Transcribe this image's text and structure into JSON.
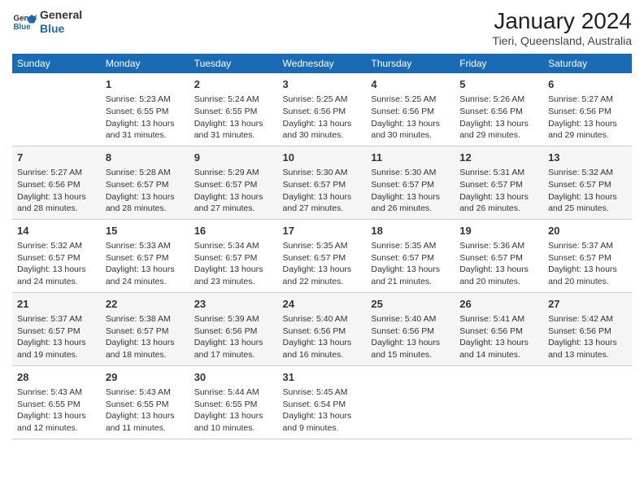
{
  "logo": {
    "line1": "General",
    "line2": "Blue"
  },
  "title": "January 2024",
  "subtitle": "Tieri, Queensland, Australia",
  "headers": [
    "Sunday",
    "Monday",
    "Tuesday",
    "Wednesday",
    "Thursday",
    "Friday",
    "Saturday"
  ],
  "weeks": [
    [
      {
        "num": "",
        "info": ""
      },
      {
        "num": "1",
        "info": "Sunrise: 5:23 AM\nSunset: 6:55 PM\nDaylight: 13 hours\nand 31 minutes."
      },
      {
        "num": "2",
        "info": "Sunrise: 5:24 AM\nSunset: 6:55 PM\nDaylight: 13 hours\nand 31 minutes."
      },
      {
        "num": "3",
        "info": "Sunrise: 5:25 AM\nSunset: 6:56 PM\nDaylight: 13 hours\nand 30 minutes."
      },
      {
        "num": "4",
        "info": "Sunrise: 5:25 AM\nSunset: 6:56 PM\nDaylight: 13 hours\nand 30 minutes."
      },
      {
        "num": "5",
        "info": "Sunrise: 5:26 AM\nSunset: 6:56 PM\nDaylight: 13 hours\nand 29 minutes."
      },
      {
        "num": "6",
        "info": "Sunrise: 5:27 AM\nSunset: 6:56 PM\nDaylight: 13 hours\nand 29 minutes."
      }
    ],
    [
      {
        "num": "7",
        "info": "Sunrise: 5:27 AM\nSunset: 6:56 PM\nDaylight: 13 hours\nand 28 minutes."
      },
      {
        "num": "8",
        "info": "Sunrise: 5:28 AM\nSunset: 6:57 PM\nDaylight: 13 hours\nand 28 minutes."
      },
      {
        "num": "9",
        "info": "Sunrise: 5:29 AM\nSunset: 6:57 PM\nDaylight: 13 hours\nand 27 minutes."
      },
      {
        "num": "10",
        "info": "Sunrise: 5:30 AM\nSunset: 6:57 PM\nDaylight: 13 hours\nand 27 minutes."
      },
      {
        "num": "11",
        "info": "Sunrise: 5:30 AM\nSunset: 6:57 PM\nDaylight: 13 hours\nand 26 minutes."
      },
      {
        "num": "12",
        "info": "Sunrise: 5:31 AM\nSunset: 6:57 PM\nDaylight: 13 hours\nand 26 minutes."
      },
      {
        "num": "13",
        "info": "Sunrise: 5:32 AM\nSunset: 6:57 PM\nDaylight: 13 hours\nand 25 minutes."
      }
    ],
    [
      {
        "num": "14",
        "info": "Sunrise: 5:32 AM\nSunset: 6:57 PM\nDaylight: 13 hours\nand 24 minutes."
      },
      {
        "num": "15",
        "info": "Sunrise: 5:33 AM\nSunset: 6:57 PM\nDaylight: 13 hours\nand 24 minutes."
      },
      {
        "num": "16",
        "info": "Sunrise: 5:34 AM\nSunset: 6:57 PM\nDaylight: 13 hours\nand 23 minutes."
      },
      {
        "num": "17",
        "info": "Sunrise: 5:35 AM\nSunset: 6:57 PM\nDaylight: 13 hours\nand 22 minutes."
      },
      {
        "num": "18",
        "info": "Sunrise: 5:35 AM\nSunset: 6:57 PM\nDaylight: 13 hours\nand 21 minutes."
      },
      {
        "num": "19",
        "info": "Sunrise: 5:36 AM\nSunset: 6:57 PM\nDaylight: 13 hours\nand 20 minutes."
      },
      {
        "num": "20",
        "info": "Sunrise: 5:37 AM\nSunset: 6:57 PM\nDaylight: 13 hours\nand 20 minutes."
      }
    ],
    [
      {
        "num": "21",
        "info": "Sunrise: 5:37 AM\nSunset: 6:57 PM\nDaylight: 13 hours\nand 19 minutes."
      },
      {
        "num": "22",
        "info": "Sunrise: 5:38 AM\nSunset: 6:57 PM\nDaylight: 13 hours\nand 18 minutes."
      },
      {
        "num": "23",
        "info": "Sunrise: 5:39 AM\nSunset: 6:56 PM\nDaylight: 13 hours\nand 17 minutes."
      },
      {
        "num": "24",
        "info": "Sunrise: 5:40 AM\nSunset: 6:56 PM\nDaylight: 13 hours\nand 16 minutes."
      },
      {
        "num": "25",
        "info": "Sunrise: 5:40 AM\nSunset: 6:56 PM\nDaylight: 13 hours\nand 15 minutes."
      },
      {
        "num": "26",
        "info": "Sunrise: 5:41 AM\nSunset: 6:56 PM\nDaylight: 13 hours\nand 14 minutes."
      },
      {
        "num": "27",
        "info": "Sunrise: 5:42 AM\nSunset: 6:56 PM\nDaylight: 13 hours\nand 13 minutes."
      }
    ],
    [
      {
        "num": "28",
        "info": "Sunrise: 5:43 AM\nSunset: 6:55 PM\nDaylight: 13 hours\nand 12 minutes."
      },
      {
        "num": "29",
        "info": "Sunrise: 5:43 AM\nSunset: 6:55 PM\nDaylight: 13 hours\nand 11 minutes."
      },
      {
        "num": "30",
        "info": "Sunrise: 5:44 AM\nSunset: 6:55 PM\nDaylight: 13 hours\nand 10 minutes."
      },
      {
        "num": "31",
        "info": "Sunrise: 5:45 AM\nSunset: 6:54 PM\nDaylight: 13 hours\nand 9 minutes."
      },
      {
        "num": "",
        "info": ""
      },
      {
        "num": "",
        "info": ""
      },
      {
        "num": "",
        "info": ""
      }
    ]
  ]
}
